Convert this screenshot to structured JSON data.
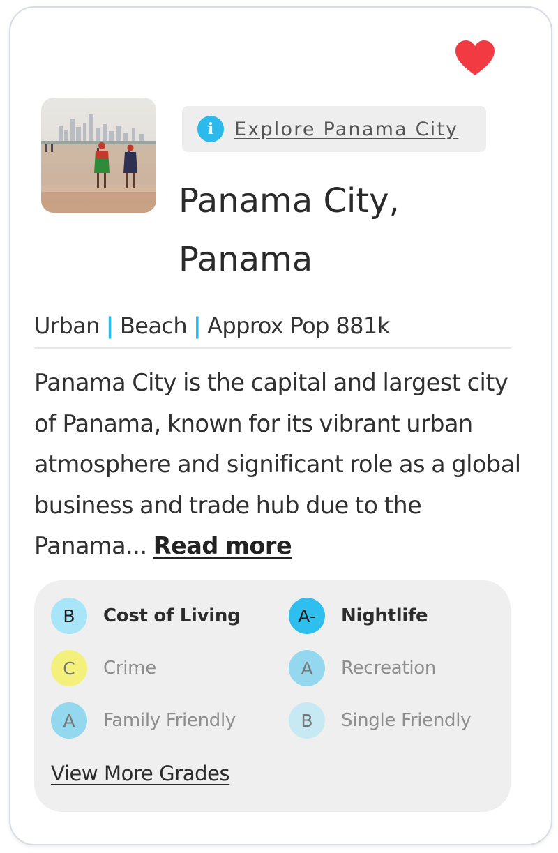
{
  "favorite": {
    "icon": "heart-icon",
    "color": "#f23a43",
    "active": true
  },
  "photo": {
    "alt": "Panama City beach with skyline"
  },
  "explore": {
    "icon": "info-icon",
    "label": "Explore Panama City",
    "accent": "#2cb9ec"
  },
  "city": {
    "title": "Panama City, Panama"
  },
  "tags": [
    "Urban",
    "Beach",
    "Approx Pop 881k"
  ],
  "description": {
    "text": "Panama City is the capital and largest city of Panama, known for its vibrant urban atmosphere and significant role as a global business and trade hub due to the Panama...",
    "read_more": "Read more"
  },
  "grades": {
    "items": [
      {
        "grade": "B",
        "label": "Cost of Living",
        "color": "#a9e5f8",
        "active": true
      },
      {
        "grade": "A-",
        "label": "Nightlife",
        "color": "#2fbfee",
        "active": true
      },
      {
        "grade": "C",
        "label": "Crime",
        "color": "#f3f07c",
        "active": false
      },
      {
        "grade": "A",
        "label": "Recreation",
        "color": "#93d8ee",
        "active": false
      },
      {
        "grade": "A",
        "label": "Family Friendly",
        "color": "#93d8ee",
        "active": false
      },
      {
        "grade": "B",
        "label": "Single Friendly",
        "color": "#c6e9f4",
        "active": false
      }
    ],
    "view_more": "View More Grades"
  }
}
